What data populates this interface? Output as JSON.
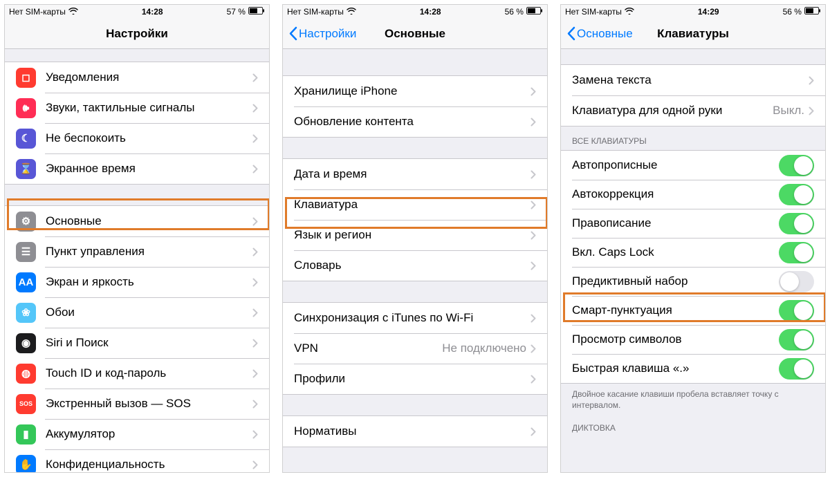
{
  "screens": {
    "settings": {
      "status": {
        "carrier": "Нет SIM-карты",
        "time": "14:28",
        "battery": "57 %"
      },
      "title": "Настройки",
      "group1": [
        {
          "label": "Уведомления",
          "iconColor": "#ff3b30",
          "iconName": "notifications-icon"
        },
        {
          "label": "Звуки, тактильные сигналы",
          "iconColor": "#ff2d55",
          "iconName": "sounds-icon"
        },
        {
          "label": "Не беспокоить",
          "iconColor": "#5856d6",
          "iconName": "dnd-icon"
        },
        {
          "label": "Экранное время",
          "iconColor": "#5856d6",
          "iconName": "screentime-icon"
        }
      ],
      "group2": [
        {
          "label": "Основные",
          "iconColor": "#8e8e93",
          "iconName": "general-icon"
        },
        {
          "label": "Пункт управления",
          "iconColor": "#8e8e93",
          "iconName": "control-center-icon"
        },
        {
          "label": "Экран и яркость",
          "iconColor": "#007aff",
          "iconName": "display-icon"
        },
        {
          "label": "Обои",
          "iconColor": "#54c6f9",
          "iconName": "wallpaper-icon"
        },
        {
          "label": "Siri и Поиск",
          "iconColor": "#1c1c1e",
          "iconName": "siri-icon"
        },
        {
          "label": "Touch ID и код-пароль",
          "iconColor": "#ff3b30",
          "iconName": "touchid-icon"
        },
        {
          "label": "Экстренный вызов — SOS",
          "iconColor": "#ff3b30",
          "iconName": "sos-icon",
          "iconText": "SOS"
        },
        {
          "label": "Аккумулятор",
          "iconColor": "#34c759",
          "iconName": "battery-icon"
        },
        {
          "label": "Конфиденциальность",
          "iconColor": "#007aff",
          "iconName": "privacy-icon"
        }
      ]
    },
    "general": {
      "status": {
        "carrier": "Нет SIM-карты",
        "time": "14:28",
        "battery": "56 %"
      },
      "back": "Настройки",
      "title": "Основные",
      "groupA": [
        {
          "label": "Хранилище iPhone"
        },
        {
          "label": "Обновление контента"
        }
      ],
      "groupB": [
        {
          "label": "Дата и время"
        },
        {
          "label": "Клавиатура"
        },
        {
          "label": "Язык и регион"
        },
        {
          "label": "Словарь"
        }
      ],
      "groupC": [
        {
          "label": "Синхронизация с iTunes по Wi-Fi"
        },
        {
          "label": "VPN",
          "detail": "Не подключено"
        },
        {
          "label": "Профили"
        }
      ],
      "groupD": [
        {
          "label": "Нормативы"
        }
      ]
    },
    "keyboards": {
      "status": {
        "carrier": "Нет SIM-карты",
        "time": "14:29",
        "battery": "56 %"
      },
      "back": "Основные",
      "title": "Клавиатуры",
      "group1": [
        {
          "label": "Замена текста"
        },
        {
          "label": "Клавиатура для одной руки",
          "detail": "Выкл."
        }
      ],
      "header2": "ВСЕ КЛАВИАТУРЫ",
      "toggles": [
        {
          "label": "Автопрописные",
          "on": true
        },
        {
          "label": "Автокоррекция",
          "on": true
        },
        {
          "label": "Правописание",
          "on": true
        },
        {
          "label": "Вкл. Caps Lock",
          "on": true
        },
        {
          "label": "Предиктивный набор",
          "on": false
        },
        {
          "label": "Смарт-пунктуация",
          "on": true
        },
        {
          "label": "Просмотр символов",
          "on": true
        },
        {
          "label": "Быстрая клавиша «.»",
          "on": true
        }
      ],
      "footer2": "Двойное касание клавиши пробела вставляет точку с интервалом.",
      "header3": "ДИКТОВКА"
    }
  }
}
